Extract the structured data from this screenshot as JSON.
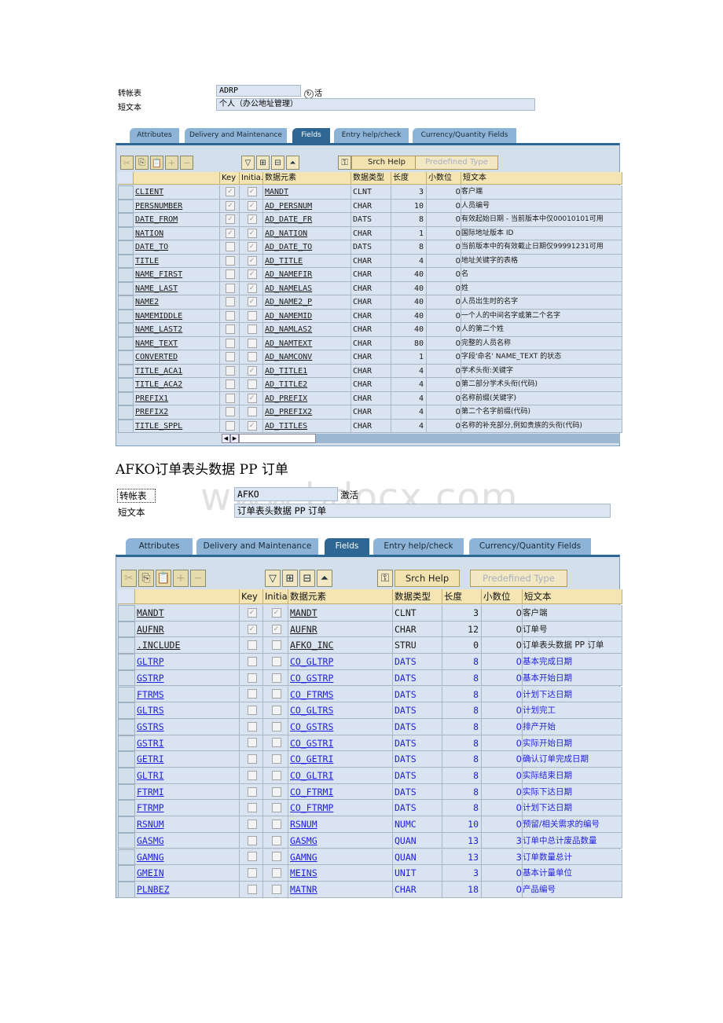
{
  "screens": [
    {
      "table_label": "转帐表",
      "table_name": "ADRP",
      "status": "活",
      "short_text_label": "短文本",
      "short_text": "个人（办公地址管理）",
      "tabs": [
        "Attributes",
        "Delivery and Maintenance",
        "Fields",
        "Entry help/check",
        "Currency/Quantity Fields"
      ],
      "active_tab": "Fields",
      "buttons": {
        "srch_help": "Srch Help",
        "predefined_type": "Predefined Type"
      },
      "columns": [
        "",
        "Key",
        "Initia...",
        "数据元素",
        "数据类型",
        "长度",
        "小数位",
        "短文本"
      ],
      "rows": [
        [
          "CLIENT",
          true,
          true,
          "MANDT",
          "CLNT",
          "3",
          "0",
          "客户端"
        ],
        [
          "PERSNUMBER",
          true,
          true,
          "AD_PERSNUM",
          "CHAR",
          "10",
          "0",
          "人员编号"
        ],
        [
          "DATE_FROM",
          true,
          true,
          "AD_DATE_FR",
          "DATS",
          "8",
          "0",
          "有效起始日期 - 当前版本中仅00010101可用"
        ],
        [
          "NATION",
          true,
          true,
          "AD_NATION",
          "CHAR",
          "1",
          "0",
          "国际地址版本 ID"
        ],
        [
          "DATE_TO",
          false,
          true,
          "AD_DATE_TO",
          "DATS",
          "8",
          "0",
          "当前版本中的有效截止日期仅99991231可用"
        ],
        [
          "TITLE",
          false,
          true,
          "AD_TITLE",
          "CHAR",
          "4",
          "0",
          "地址关键字的表格"
        ],
        [
          "NAME_FIRST",
          false,
          true,
          "AD_NAMEFIR",
          "CHAR",
          "40",
          "0",
          "名"
        ],
        [
          "NAME_LAST",
          false,
          true,
          "AD_NAMELAS",
          "CHAR",
          "40",
          "0",
          "姓"
        ],
        [
          "NAME2",
          false,
          true,
          "AD_NAME2_P",
          "CHAR",
          "40",
          "0",
          "人员出生时的名字"
        ],
        [
          "NAMEMIDDLE",
          false,
          false,
          "AD_NAMEMID",
          "CHAR",
          "40",
          "0",
          "一个人的中间名字或第二个名字"
        ],
        [
          "NAME_LAST2",
          false,
          false,
          "AD_NAMLAS2",
          "CHAR",
          "40",
          "0",
          "人的第二个姓"
        ],
        [
          "NAME_TEXT",
          false,
          false,
          "AD_NAMTEXT",
          "CHAR",
          "80",
          "0",
          "完整的人员名称"
        ],
        [
          "CONVERTED",
          false,
          false,
          "AD_NAMCONV",
          "CHAR",
          "1",
          "0",
          "字段'命名' NAME_TEXT 的状态"
        ],
        [
          "TITLE_ACA1",
          false,
          true,
          "AD_TITLE1",
          "CHAR",
          "4",
          "0",
          "学术头衔:关键字"
        ],
        [
          "TITLE_ACA2",
          false,
          false,
          "AD_TITLE2",
          "CHAR",
          "4",
          "0",
          "第二部分学术头衔(代码)"
        ],
        [
          "PREFIX1",
          false,
          true,
          "AD_PREFIX",
          "CHAR",
          "4",
          "0",
          "名称前缀(关键字)"
        ],
        [
          "PREFIX2",
          false,
          false,
          "AD_PREFIX2",
          "CHAR",
          "4",
          "0",
          "第二个名字前缀(代码)"
        ],
        [
          "TITLE_SPPL",
          false,
          true,
          "AD_TITLES",
          "CHAR",
          "4",
          "0",
          "名称的补充部分,例如贵族的头衔(代码)"
        ]
      ],
      "blue_from_row": 99
    },
    {
      "table_label": "转帐表",
      "table_name": "AFKO",
      "status": "激活",
      "short_text_label": "短文本",
      "short_text": "订单表头数据 PP 订单",
      "tabs": [
        "Attributes",
        "Delivery and Maintenance",
        "Fields",
        "Entry help/check",
        "Currency/Quantity Fields"
      ],
      "active_tab": "Fields",
      "buttons": {
        "srch_help": "Srch Help",
        "predefined_type": "Predefined Type"
      },
      "columns": [
        "",
        "Key",
        "Initia...",
        "数据元素",
        "数据类型",
        "长度",
        "小数位",
        "短文本"
      ],
      "rows": [
        [
          "MANDT",
          true,
          true,
          "MANDT",
          "CLNT",
          "3",
          "0",
          "客户端"
        ],
        [
          "AUFNR",
          true,
          true,
          "AUFNR",
          "CHAR",
          "12",
          "0",
          "订单号"
        ],
        [
          ".INCLUDE",
          false,
          false,
          "AFKO_INC",
          "STRU",
          "0",
          "0",
          "订单表头数据 PP 订单"
        ],
        [
          "GLTRP",
          false,
          false,
          "CO_GLTRP",
          "DATS",
          "8",
          "0",
          "基本完成日期"
        ],
        [
          "GSTRP",
          false,
          false,
          "CO_GSTRP",
          "DATS",
          "8",
          "0",
          "基本开始日期"
        ],
        [
          "FTRMS",
          false,
          false,
          "CO_FTRMS",
          "DATS",
          "8",
          "0",
          "计划下达日期"
        ],
        [
          "GLTRS",
          false,
          false,
          "CO_GLTRS",
          "DATS",
          "8",
          "0",
          "计划完工"
        ],
        [
          "GSTRS",
          false,
          false,
          "CO_GSTRS",
          "DATS",
          "8",
          "0",
          "排产开始"
        ],
        [
          "GSTRI",
          false,
          false,
          "CO_GSTRI",
          "DATS",
          "8",
          "0",
          "实际开始日期"
        ],
        [
          "GETRI",
          false,
          false,
          "CO_GETRI",
          "DATS",
          "8",
          "0",
          "确认订单完成日期"
        ],
        [
          "GLTRI",
          false,
          false,
          "CO_GLTRI",
          "DATS",
          "8",
          "0",
          "实际结束日期"
        ],
        [
          "FTRMI",
          false,
          false,
          "CO_FTRMI",
          "DATS",
          "8",
          "0",
          "实际下达日期"
        ],
        [
          "FTRMP",
          false,
          false,
          "CO_FTRMP",
          "DATS",
          "8",
          "0",
          "计划下达日期"
        ],
        [
          "RSNUM",
          false,
          false,
          "RSNUM",
          "NUMC",
          "10",
          "0",
          "预留/相关需求的编号"
        ],
        [
          "GASMG",
          false,
          false,
          "GASMG",
          "QUAN",
          "13",
          "3",
          "订单中总计废品数量"
        ],
        [
          "GAMNG",
          false,
          false,
          "GAMNG",
          "QUAN",
          "13",
          "3",
          "订单数量总计"
        ],
        [
          "GMEIN",
          false,
          false,
          "MEINS",
          "UNIT",
          "3",
          "0",
          "基本计量单位"
        ],
        [
          "PLNBEZ",
          false,
          false,
          "MATNR",
          "CHAR",
          "18",
          "0",
          "产品编号"
        ]
      ],
      "blue_from_row": 3
    }
  ],
  "heading": "AFKO订单表头数据 PP 订单",
  "watermark": "www.bdocx.com",
  "colors": {
    "link_dark": "#1a1a1a",
    "link_blue": "#1f1fe0",
    "active_tab": "#2e6694",
    "tab": "#8db3d6",
    "row_bg": "#dae4f0",
    "header_bg": "#f5e5b3"
  },
  "icons": [
    "cut-icon",
    "copy-icon",
    "paste-icon",
    "insert-row-icon",
    "delete-row-icon",
    "sort-icon",
    "expand-icon",
    "collapse-icon",
    "up-icon",
    "search-help-key-icon"
  ]
}
